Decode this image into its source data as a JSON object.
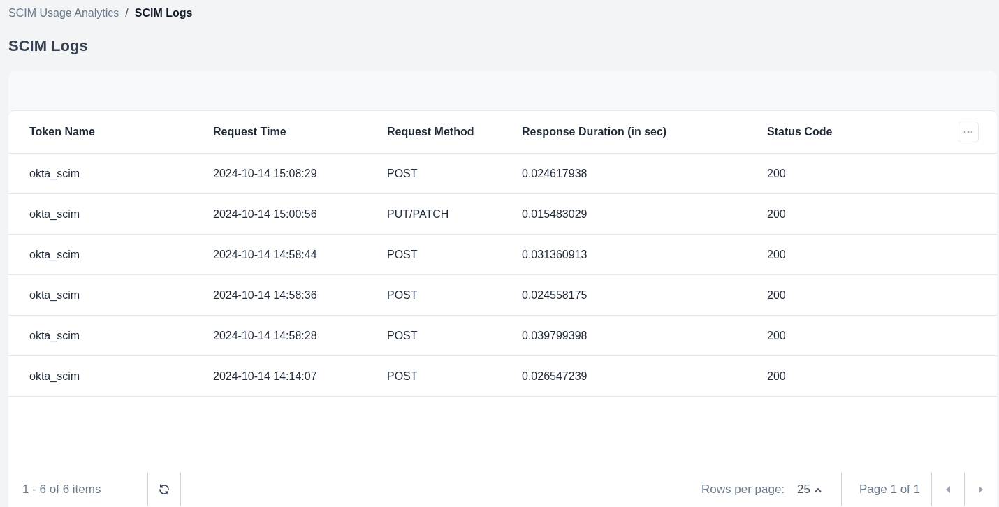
{
  "breadcrumb": {
    "parent": "SCIM Usage Analytics",
    "separator": "/",
    "current": "SCIM Logs"
  },
  "title": "SCIM Logs",
  "table": {
    "columns": [
      "Token Name",
      "Request Time",
      "Request Method",
      "Response Duration (in sec)",
      "Status Code"
    ],
    "rows": [
      [
        "okta_scim",
        "2024-10-14 15:08:29",
        "POST",
        "0.024617938",
        "200"
      ],
      [
        "okta_scim",
        "2024-10-14 15:00:56",
        "PUT/PATCH",
        "0.015483029",
        "200"
      ],
      [
        "okta_scim",
        "2024-10-14 14:58:44",
        "POST",
        "0.031360913",
        "200"
      ],
      [
        "okta_scim",
        "2024-10-14 14:58:36",
        "POST",
        "0.024558175",
        "200"
      ],
      [
        "okta_scim",
        "2024-10-14 14:58:28",
        "POST",
        "0.039799398",
        "200"
      ],
      [
        "okta_scim",
        "2024-10-14 14:14:07",
        "POST",
        "0.026547239",
        "200"
      ]
    ]
  },
  "footer": {
    "items_summary": "1 - 6 of 6 items",
    "rows_per_page_label": "Rows per page:",
    "rows_per_page": "25",
    "page_info": "Page 1 of 1"
  }
}
